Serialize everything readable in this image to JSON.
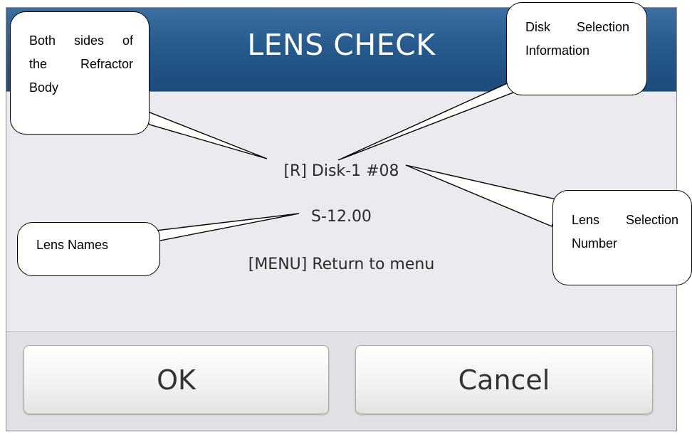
{
  "dialog": {
    "title": "LENS CHECK",
    "disk_info": "[R] Disk-1 #08",
    "lens_name": "S-12.00",
    "menu_hint": "[MENU] Return to menu",
    "ok_label": "OK",
    "cancel_label": "Cancel"
  },
  "callouts": {
    "both_sides": {
      "w1": "Both",
      "w2": "sides",
      "w3": "of",
      "w4": "the",
      "w5": "Refractor",
      "w6": "Body"
    },
    "disk_selection": {
      "w1": "Disk",
      "w2": "Selection",
      "w3": "Information"
    },
    "lens_selection": {
      "w1": "Lens",
      "w2": "Selection",
      "w3": "Number"
    },
    "lens_names": {
      "text": "Lens Names"
    }
  },
  "colors": {
    "title_bar": "#275a8d",
    "dialog_bg": "#e9ebee",
    "footer_bg": "#dfe1e4"
  }
}
